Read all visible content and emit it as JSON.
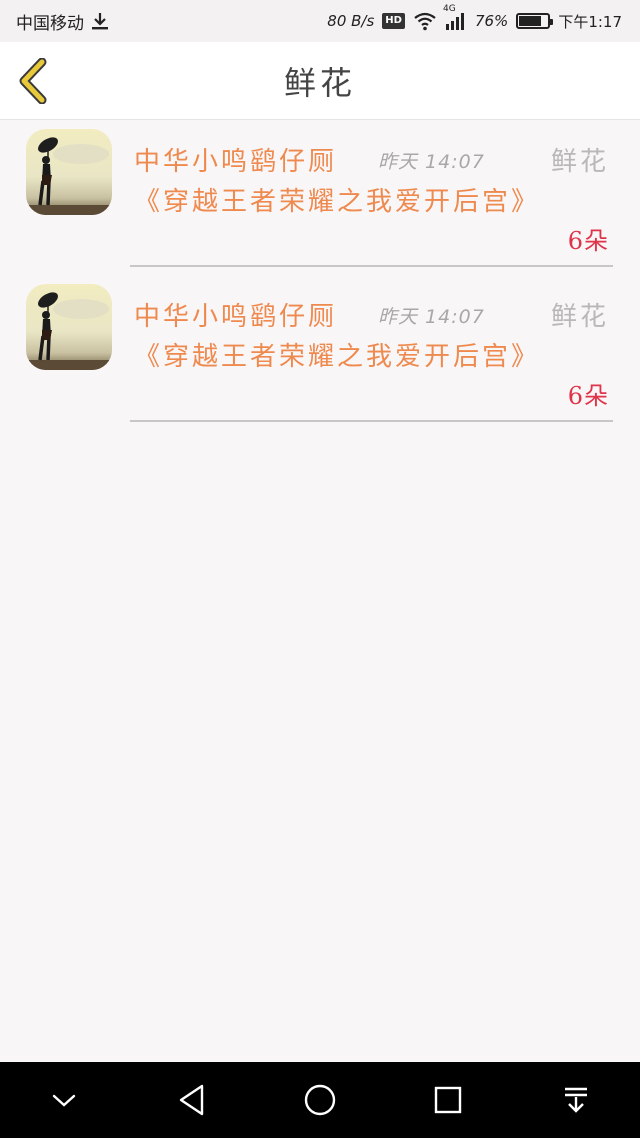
{
  "status_bar": {
    "carrier": "中国移动",
    "speed": "80 B/s",
    "hd": "HD",
    "network": "4G",
    "battery": "76%",
    "battery_level": 0.76,
    "time": "下午1:17"
  },
  "header": {
    "title": "鲜花"
  },
  "list": {
    "items": [
      {
        "sender": "中华小鸣鹞仔厕",
        "time": "昨天 14:07",
        "gift_type": "鲜花",
        "message": "《穿越王者荣耀之我爱开后宫》",
        "count": "6朵"
      },
      {
        "sender": "中华小鸣鹞仔厕",
        "time": "昨天 14:07",
        "gift_type": "鲜花",
        "message": "《穿越王者荣耀之我爱开后宫》",
        "count": "6朵"
      }
    ]
  },
  "nav_bar": {
    "icons": [
      "chevron-down-icon",
      "back-triangle-icon",
      "home-circle-icon",
      "recents-square-icon",
      "notification-pull-icon"
    ]
  },
  "colors": {
    "accent_orange": "#ef8a4f",
    "count_red": "#e0344a",
    "back_yellow": "#e8c93a"
  }
}
